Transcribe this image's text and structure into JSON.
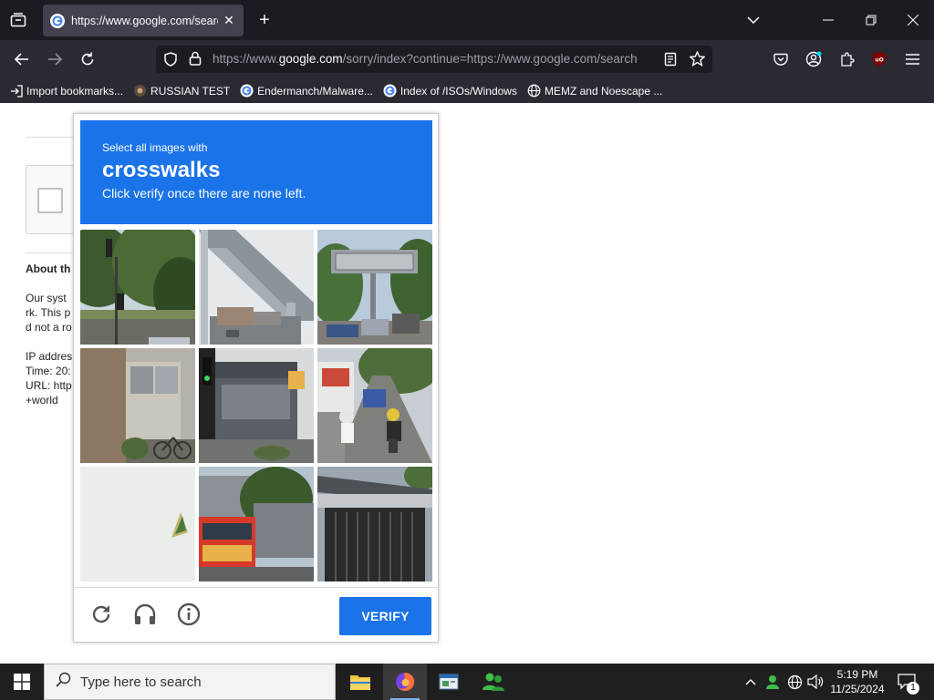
{
  "browser": {
    "tab_title": "https://www.google.com/searc",
    "url_prefix": "https://www.",
    "url_domain": "google.com",
    "url_rest": "/sorry/index?continue=https://www.google.com/search"
  },
  "bookmarks": [
    {
      "label": "Import bookmarks..."
    },
    {
      "label": "RUSSIAN TEST"
    },
    {
      "label": "Endermanch/Malware..."
    },
    {
      "label": "Index of /ISOs/Windows"
    },
    {
      "label": "MEMZ and Noescape ..."
    }
  ],
  "background_page": {
    "about": "About th",
    "lines": [
      "Our syst",
      "rk. This p",
      "d not a ro"
    ],
    "ip": "IP addres",
    "time": "Time: 20:",
    "url": "URL: http",
    "world": "+world"
  },
  "captcha": {
    "instruction": "Select all images with",
    "target": "crosswalks",
    "subtext": "Click verify once there are none left.",
    "verify_label": "VERIFY"
  },
  "taskbar": {
    "search_placeholder": "Type here to search",
    "time": "5:19 PM",
    "date": "11/25/2024",
    "notification_count": "1"
  },
  "colors": {
    "captcha_blue": "#1a73e8",
    "browser_dark": "#1c1b22",
    "toolbar": "#2b2a33"
  }
}
